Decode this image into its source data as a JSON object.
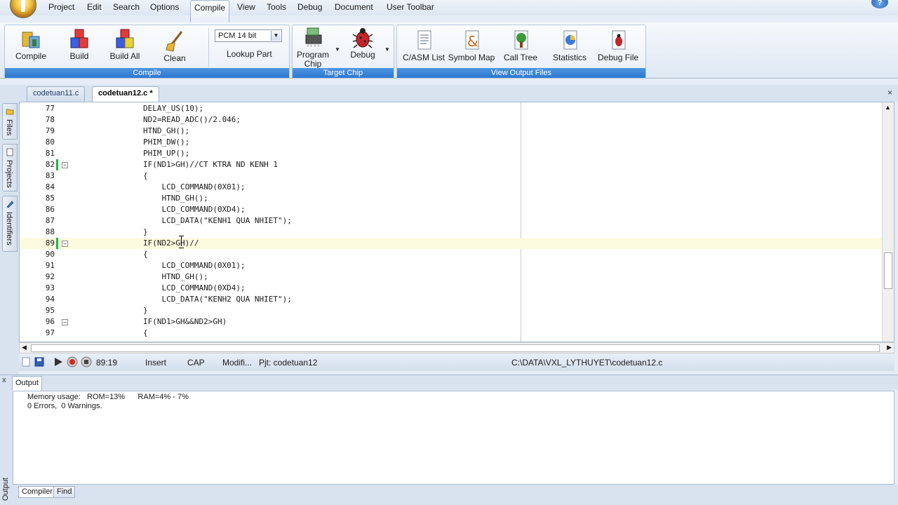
{
  "menu": {
    "items": [
      "Project",
      "Edit",
      "Search",
      "Options",
      "Compile",
      "View",
      "Tools",
      "Debug",
      "Document",
      "User Toolbar"
    ],
    "active": "Compile",
    "help_glyph": "?"
  },
  "ribbon": {
    "compile_group": {
      "label": "Compile",
      "buttons": {
        "compile": "Compile",
        "build": "Build",
        "build_all": "Build All",
        "clean": "Clean"
      },
      "device_select": "PCM 14 bit",
      "lookup_part": "Lookup Part"
    },
    "target_group": {
      "label": "Target Chip",
      "program_chip_1": "Program",
      "program_chip_2": "Chip",
      "debug": "Debug"
    },
    "output_group": {
      "label": "View Output Files",
      "c_asm_list": "C/ASM List",
      "symbol_map": "Symbol Map",
      "call_tree": "Call Tree",
      "statistics": "Statistics",
      "debug_file": "Debug File"
    }
  },
  "tabs": {
    "file1": "codetuan11.c",
    "file2": "codetuan12.c *",
    "close_glyph": "×"
  },
  "side_tabs": {
    "files": "Files",
    "projects": "Projects",
    "identifiers": "Identifiers"
  },
  "editor": {
    "lines": [
      {
        "num": "77",
        "text": "        DELAY_US(10);",
        "mod": false,
        "fold": false
      },
      {
        "num": "78",
        "text": "        ND2=READ_ADC()/2.046;",
        "mod": false,
        "fold": false
      },
      {
        "num": "79",
        "text": "        HTND_GH();",
        "mod": false,
        "fold": false
      },
      {
        "num": "80",
        "text": "        PHIM_DW();",
        "mod": false,
        "fold": false
      },
      {
        "num": "81",
        "text": "        PHIM_UP();",
        "mod": false,
        "fold": false
      },
      {
        "num": "82",
        "text": "        IF(ND1>GH)//CT KTRA ND KENH 1",
        "mod": true,
        "fold": true
      },
      {
        "num": "83",
        "text": "        {",
        "mod": false,
        "fold": false
      },
      {
        "num": "84",
        "text": "            LCD_COMMAND(0X01);",
        "mod": false,
        "fold": false
      },
      {
        "num": "85",
        "text": "            HTND_GH();",
        "mod": false,
        "fold": false
      },
      {
        "num": "86",
        "text": "            LCD_COMMAND(0XD4);",
        "mod": false,
        "fold": false
      },
      {
        "num": "87",
        "text": "            LCD_DATA(\"KENH1 QUA NHIET\");",
        "mod": false,
        "fold": false
      },
      {
        "num": "88",
        "text": "        }",
        "mod": false,
        "fold": false
      },
      {
        "num": "89",
        "text": "        IF(ND2>GH)//",
        "mod": true,
        "fold": true,
        "current": true
      },
      {
        "num": "90",
        "text": "        {",
        "mod": false,
        "fold": false
      },
      {
        "num": "91",
        "text": "            LCD_COMMAND(0X01);",
        "mod": false,
        "fold": false
      },
      {
        "num": "92",
        "text": "            HTND_GH();",
        "mod": false,
        "fold": false
      },
      {
        "num": "93",
        "text": "            LCD_COMMAND(0XD4);",
        "mod": false,
        "fold": false
      },
      {
        "num": "94",
        "text": "            LCD_DATA(\"KENH2 QUA NHIET\");",
        "mod": false,
        "fold": false
      },
      {
        "num": "95",
        "text": "        }",
        "mod": false,
        "fold": false
      },
      {
        "num": "96",
        "text": "        IF(ND1>GH&&ND2>GH)",
        "mod": false,
        "fold": true
      },
      {
        "num": "97",
        "text": "        {",
        "mod": false,
        "fold": false
      }
    ]
  },
  "statusbar": {
    "position": "89:19",
    "mode": "Insert",
    "caps": "CAP",
    "modified": "Modifi...",
    "project": "Pjt: codetuan12",
    "path": "C:\\DATA\\VXL_LYTHUYET\\codetuan12.c"
  },
  "output": {
    "tab": "Output",
    "close_glyph": "x",
    "side_label": "Output",
    "line1": "Memory usage:   ROM=13%      RAM=4% - 7%",
    "line2": "0 Errors,  0 Warnings.",
    "bottom_tabs": {
      "compiler": "Compiler",
      "find": "Find"
    }
  },
  "colors": {
    "ribbon_label_bg": "#2b78d0",
    "modified_marker": "#22b14c",
    "current_line_bg": "#fbfbe0"
  }
}
